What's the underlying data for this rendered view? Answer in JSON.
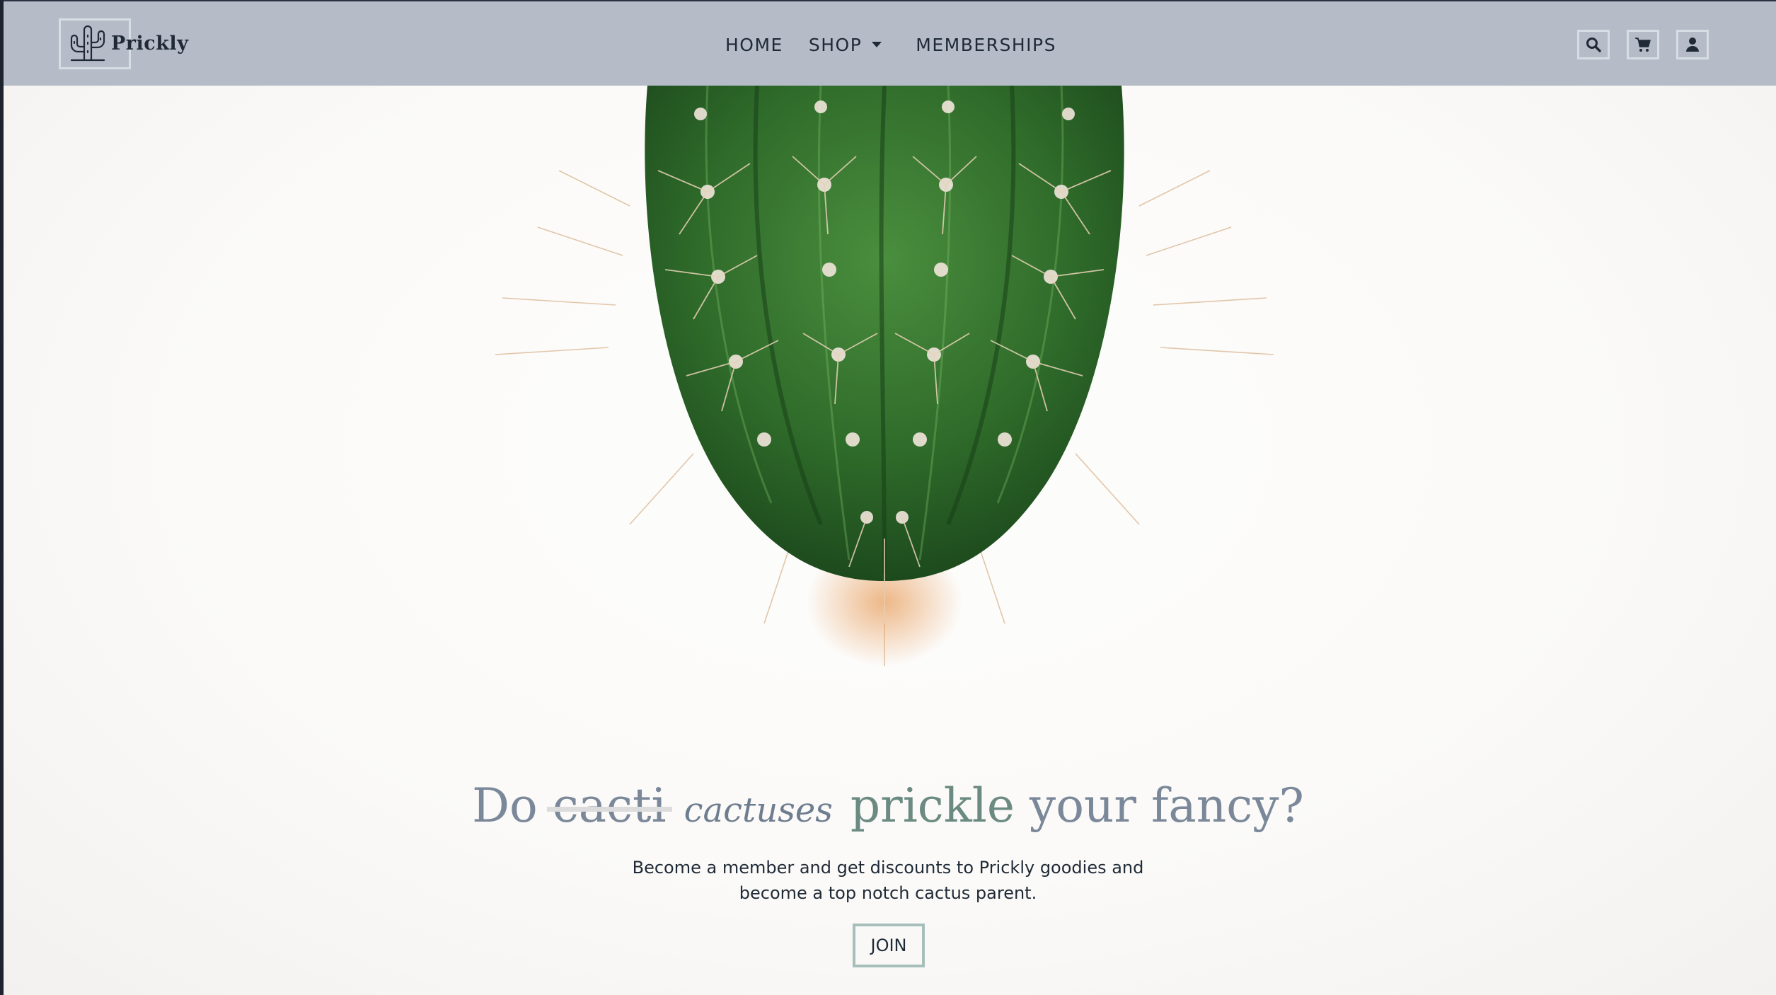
{
  "brand": {
    "name": "Prickly",
    "logo_icon": "cactus-logo-icon"
  },
  "nav": {
    "links": [
      {
        "label": "HOME",
        "active": true
      },
      {
        "label": "SHOP",
        "has_dropdown": true
      },
      {
        "label": "MEMBERSHIPS"
      }
    ],
    "icons": [
      "search-icon",
      "cart-icon",
      "user-icon"
    ]
  },
  "hero": {
    "image": "cactus-photo",
    "headline": {
      "prefix": "Do",
      "struck": "cacti",
      "cursive": "cactuses",
      "highlight": "prickle",
      "suffix": "your fancy?"
    },
    "subtext": "Become a member and get discounts to Prickly goodies and become a top notch cactus parent.",
    "cta_label": "JOIN"
  },
  "colors": {
    "navbar": "#b5bcc8",
    "text_dark": "#1f2a36",
    "headline": "#7a8899",
    "accent_green": "#6b8a82",
    "button_border": "#a6bfbb",
    "active_underline": "#e8d8d8"
  }
}
